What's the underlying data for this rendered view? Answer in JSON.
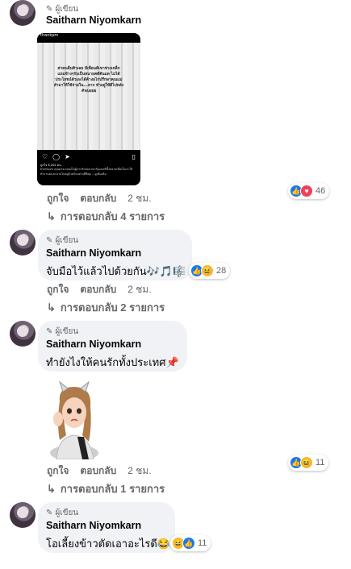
{
  "comments": [
    {
      "badge": "ผู้เขียน",
      "name": "Saitharn Niyomkarn",
      "text": "",
      "actions": {
        "like": "ถูกใจ",
        "reply": "ตอบกลับ",
        "time": "2 ชม."
      },
      "replies": "การตอบกลับ 4 รายการ",
      "reactions": {
        "count": "46"
      }
    },
    {
      "badge": "ผู้เขียน",
      "name": "Saitharn Niyomkarn",
      "text": "จับมือไว้แล้วไปด้วยกัน🎶🎵🎼",
      "actions": {
        "like": "ถูกใจ",
        "reply": "ตอบกลับ",
        "time": "2 ชม."
      },
      "replies": "การตอบกลับ 2 รายการ",
      "reactions": {
        "count": "28"
      }
    },
    {
      "badge": "ผู้เขียน",
      "name": "Saitharn Niyomkarn",
      "text": "ทำยังไงให้คนรักทั้งประเทศ📌",
      "actions": {
        "like": "ถูกใจ",
        "reply": "ตอบกลับ",
        "time": "2 ชม."
      },
      "replies": "การตอบกลับ 1 รายการ",
      "reactions": {
        "count": "11"
      }
    },
    {
      "badge": "ผู้เขียน",
      "name": "Saitharn Niyomkarn",
      "text": "โอเลี้ยงข้าวตัดเอาอะไรดี😂",
      "reactions": {
        "count": "11"
      }
    }
  ],
  "post": {
    "account": "thankpm",
    "image_text": "ค่าคนอื่นทิวเลย มีเพื่อนดีเขาช่วงเหล็ก แถมข้างๆรับเป็นหนายคดีต้นแด ไม่ได้ประโยชน์ตัวเองได้ค้างอไก่ปรึกษาคุณแม่ สำมาให้ใช้จ่ายใน...ลาก ทำอยู่ให้ดีไปหลัง #พบยยย",
    "likes": "ถูกใจ 6,202 คน",
    "caption": "thankpm คุณคงจะเคยเป็นผู้กระทำต่อนายกรัฐมนตรีทั้งหลายเพื่อเป็นจะให้ทำงานคนละนายไปอยู่ด้วยกันอย่างดีที่สุด ...ดูเพิ่มเติม"
  },
  "icons": {
    "pen": "pencil-icon",
    "reply_arrow": "reply-arrow-icon",
    "like": "like-reaction-icon",
    "love": "love-reaction-icon",
    "haha": "haha-reaction-icon"
  }
}
